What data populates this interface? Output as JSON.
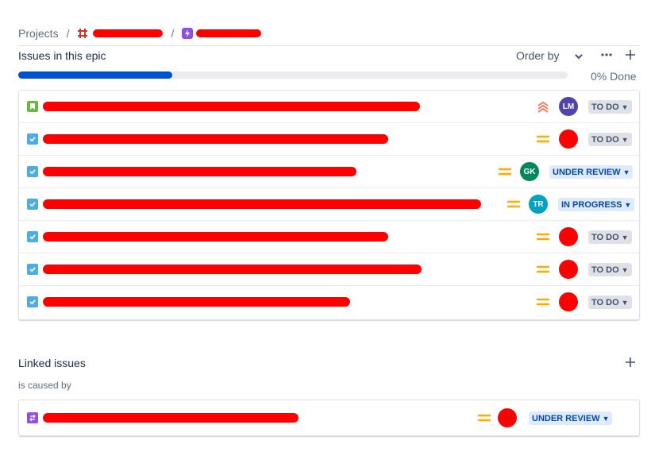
{
  "breadcrumb": {
    "root": "Projects",
    "separator": "/"
  },
  "epic_section": {
    "title": "Issues in this epic",
    "order_by_label": "Order by",
    "progress_percent": 28,
    "progress_label": "0% Done"
  },
  "issues": [
    {
      "type": "story",
      "priority": "highest",
      "assignee_initials": "LM",
      "assignee_color": "#5243aa",
      "status": "TO DO",
      "status_kind": "todo",
      "redact_width": 475
    },
    {
      "type": "task",
      "priority": "medium",
      "assignee_initials": "",
      "assignee_color": "#ff0000",
      "status": "TO DO",
      "status_kind": "todo",
      "redact_width": 435
    },
    {
      "type": "task",
      "priority": "medium",
      "assignee_initials": "GK",
      "assignee_color": "#00875a",
      "status": "UNDER REVIEW",
      "status_kind": "review",
      "redact_width": 395
    },
    {
      "type": "task",
      "priority": "medium",
      "assignee_initials": "TR",
      "assignee_color": "#00a3bf",
      "status": "IN PROGRESS",
      "status_kind": "progress",
      "redact_width": 552
    },
    {
      "type": "task",
      "priority": "medium",
      "assignee_initials": "",
      "assignee_color": "#ff0000",
      "status": "TO DO",
      "status_kind": "todo",
      "redact_width": 435
    },
    {
      "type": "task",
      "priority": "medium",
      "assignee_initials": "",
      "assignee_color": "#ff0000",
      "status": "TO DO",
      "status_kind": "todo",
      "redact_width": 477
    },
    {
      "type": "task",
      "priority": "medium",
      "assignee_initials": "",
      "assignee_color": "#ff0000",
      "status": "TO DO",
      "status_kind": "todo",
      "redact_width": 387
    }
  ],
  "linked_section": {
    "title": "Linked issues",
    "relation": "is caused by",
    "items": [
      {
        "type": "change",
        "priority": "medium",
        "status": "UNDER REVIEW",
        "status_kind": "review"
      }
    ]
  },
  "colors": {
    "accent": "#0052cc",
    "priority_medium": "#ffab00",
    "priority_highest": "#ff7452",
    "story": "#63ba3c",
    "task": "#4bade8",
    "epic": "#904ee2"
  }
}
